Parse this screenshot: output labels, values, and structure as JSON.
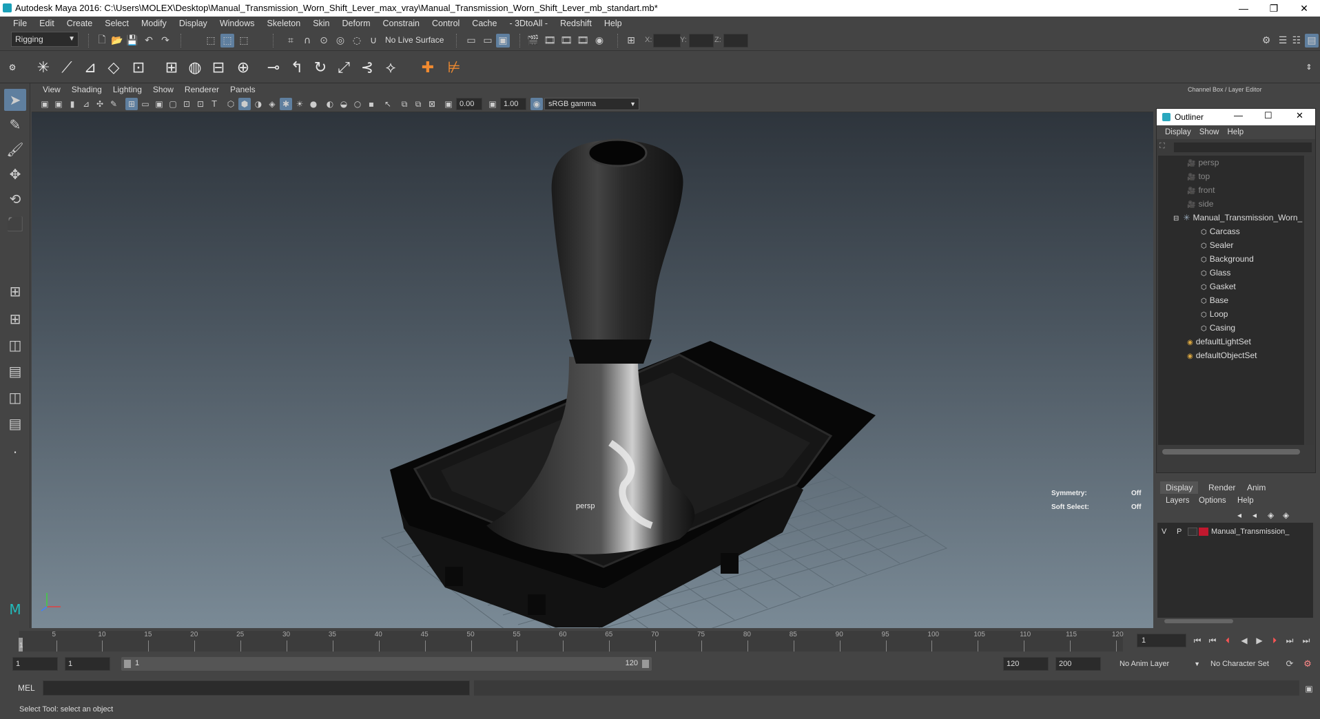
{
  "window": {
    "title": "Autodesk Maya 2016: C:\\Users\\MOLEX\\Desktop\\Manual_Transmission_Worn_Shift_Lever_max_vray\\Manual_Transmission_Worn_Shift_Lever_mb_standart.mb*",
    "minimize": "—",
    "restore": "❐",
    "close": "✕"
  },
  "menu": [
    "File",
    "Edit",
    "Create",
    "Select",
    "Modify",
    "Display",
    "Windows",
    "Skeleton",
    "Skin",
    "Deform",
    "Constrain",
    "Control",
    "Cache",
    "- 3DtoAll -",
    "Redshift",
    "Help"
  ],
  "status": {
    "mode": "Rigging",
    "live_surface": "No Live Surface",
    "x_label": "X:",
    "y_label": "Y:",
    "z_label": "Z:"
  },
  "viewport": {
    "menu": [
      "View",
      "Shading",
      "Lighting",
      "Show",
      "Renderer",
      "Panels"
    ],
    "exposure": "0.00",
    "gamma": "1.00",
    "color_space": "sRGB gamma",
    "camera": "persp",
    "symmetry_label": "Symmetry:",
    "symmetry_value": "Off",
    "soft_select_label": "Soft Select:",
    "soft_select_value": "Off"
  },
  "right_panel": {
    "header": "Channel Box / Layer Editor"
  },
  "outliner": {
    "title": "Outliner",
    "menu": [
      "Display",
      "Show",
      "Help"
    ],
    "items": [
      {
        "label": "persp",
        "dim": true
      },
      {
        "label": "top",
        "dim": true
      },
      {
        "label": "front",
        "dim": true
      },
      {
        "label": "side",
        "dim": true
      },
      {
        "label": "Manual_Transmission_Worn_",
        "dim": false
      },
      {
        "label": "Carcass",
        "dim": false
      },
      {
        "label": "Sealer",
        "dim": false
      },
      {
        "label": "Background",
        "dim": false
      },
      {
        "label": "Glass",
        "dim": false
      },
      {
        "label": "Gasket",
        "dim": false
      },
      {
        "label": "Base",
        "dim": false
      },
      {
        "label": "Loop",
        "dim": false
      },
      {
        "label": "Casing",
        "dim": false
      },
      {
        "label": "defaultLightSet",
        "dim": false
      },
      {
        "label": "defaultObjectSet",
        "dim": false
      }
    ]
  },
  "layers": {
    "tabs": [
      "Display",
      "Render",
      "Anim"
    ],
    "menu": [
      "Layers",
      "Options",
      "Help"
    ],
    "row": {
      "v": "V",
      "p": "P",
      "name": "Manual_Transmission_",
      "color": "#c0182e"
    }
  },
  "timeline": {
    "ticks": [
      "5",
      "10",
      "15",
      "20",
      "25",
      "30",
      "35",
      "40",
      "45",
      "50",
      "55",
      "60",
      "65",
      "70",
      "75",
      "80",
      "85",
      "90",
      "95",
      "100",
      "105",
      "110",
      "115",
      "120"
    ],
    "current_frame": "1",
    "current_field": "1"
  },
  "range": {
    "start": "1",
    "anim_start": "1",
    "slider_start": "1",
    "slider_end": "120",
    "end": "120",
    "anim_end": "200",
    "anim_layer": "No Anim Layer",
    "char_set": "No Character Set"
  },
  "cmd": {
    "label": "MEL"
  },
  "help": {
    "text": "Select Tool: select an object"
  }
}
